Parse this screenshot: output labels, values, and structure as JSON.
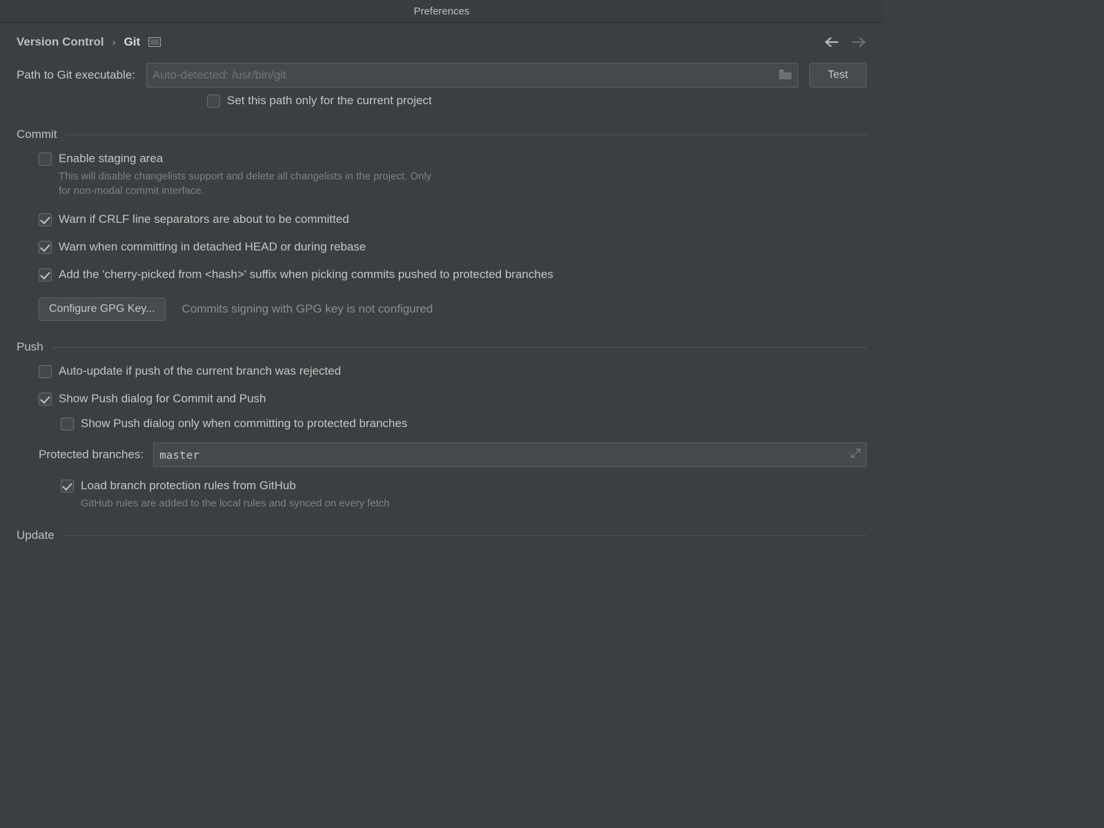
{
  "window": {
    "title": "Preferences"
  },
  "breadcrumb": {
    "parent": "Version Control",
    "current": "Git"
  },
  "path": {
    "label": "Path to Git executable:",
    "placeholder": "Auto-detected: /usr/bin/git",
    "test_button": "Test",
    "set_only_project": "Set this path only for the current project"
  },
  "sections": {
    "commit": {
      "title": "Commit",
      "enable_staging": "Enable staging area",
      "enable_staging_help": "This will disable changelists support and delete all changelists in the project. Only for non-modal commit interface.",
      "warn_crlf": "Warn if CRLF line separators are about to be committed",
      "warn_detached": "Warn when committing in detached HEAD or during rebase",
      "cherry_suffix": "Add the 'cherry-picked from <hash>' suffix when picking commits pushed to protected branches",
      "gpg_button": "Configure GPG Key...",
      "gpg_status": "Commits signing with GPG key is not configured"
    },
    "push": {
      "title": "Push",
      "auto_update": "Auto-update if push of the current branch was rejected",
      "show_push_dialog": "Show Push dialog for Commit and Push",
      "show_push_only_protected": "Show Push dialog only when committing to protected branches",
      "protected_label": "Protected branches:",
      "protected_value": "master",
      "load_github": "Load branch protection rules from GitHub",
      "load_github_help": "GitHub rules are added to the local rules and synced on every fetch"
    },
    "update": {
      "title": "Update"
    }
  }
}
